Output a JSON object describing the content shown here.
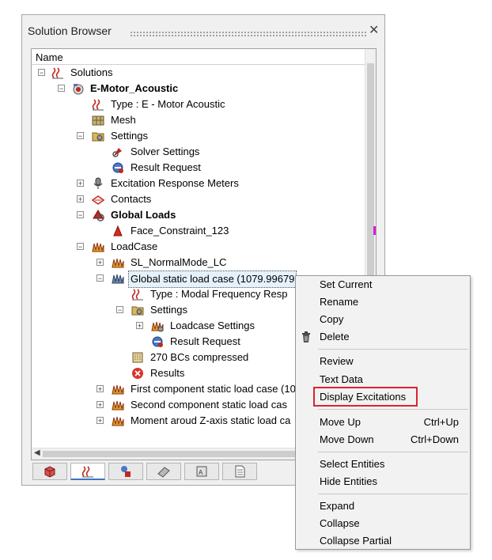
{
  "panel": {
    "title": "Solution Browser"
  },
  "tree": {
    "column": "Name",
    "rows": [
      {
        "label": "Solutions"
      },
      {
        "label": "E-Motor_Acoustic"
      },
      {
        "label": "Type : E - Motor Acoustic"
      },
      {
        "label": "Mesh"
      },
      {
        "label": "Settings"
      },
      {
        "label": "Solver Settings"
      },
      {
        "label": "Result Request"
      },
      {
        "label": "Excitation Response Meters"
      },
      {
        "label": "Contacts"
      },
      {
        "label": "Global Loads"
      },
      {
        "label": "Face_Constraint_123"
      },
      {
        "label": "LoadCase"
      },
      {
        "label": "SL_NormalMode_LC"
      },
      {
        "label": "Global static load case (1079.99679"
      },
      {
        "label": "Type : Modal Frequency Resp"
      },
      {
        "label": "Settings"
      },
      {
        "label": "Loadcase Settings"
      },
      {
        "label": "Result Request"
      },
      {
        "label": "270 BCs compressed"
      },
      {
        "label": "Results"
      },
      {
        "label": "First component static load case (10"
      },
      {
        "label": "Second component static load cas"
      },
      {
        "label": "Moment aroud Z-axis static load ca"
      }
    ]
  },
  "context_menu": {
    "items": [
      {
        "label": "Set Current"
      },
      {
        "label": "Rename"
      },
      {
        "label": "Copy"
      },
      {
        "label": "Delete"
      },
      {
        "label": "Review"
      },
      {
        "label": "Text Data"
      },
      {
        "label": "Display Excitations"
      },
      {
        "label": "Move Up",
        "shortcut": "Ctrl+Up"
      },
      {
        "label": "Move Down",
        "shortcut": "Ctrl+Down"
      },
      {
        "label": "Select Entities"
      },
      {
        "label": "Hide Entities"
      },
      {
        "label": "Expand"
      },
      {
        "label": "Collapse"
      },
      {
        "label": "Collapse Partial"
      }
    ]
  },
  "colors": {
    "highlight_border": "#d9252f",
    "tab_active": "#3a74c8"
  }
}
